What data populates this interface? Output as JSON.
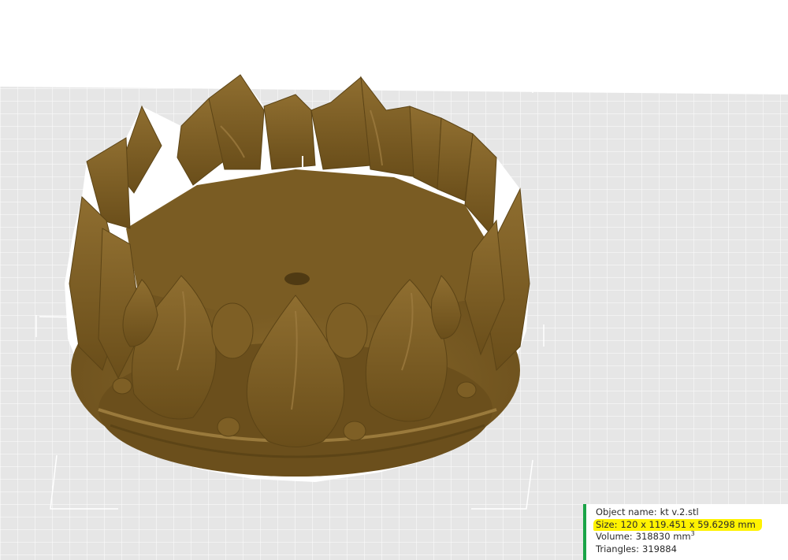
{
  "colors": {
    "bed": "#e6e6e6",
    "grid_line": "#ffffff",
    "model": "#7a5c23",
    "model_shadow": "#5c4416",
    "model_highlight": "#98763a",
    "outline": "#ffffff",
    "panel_accent": "#1aa447",
    "highlight_marker": "#fff200"
  },
  "icons": {
    "model": "crown-3d-model",
    "bounding_box": "bounding-box-corners"
  },
  "object_info": {
    "name_label": "Object name:",
    "name_value": "kt v.2.stl",
    "size_label": "Size:",
    "size_value": "120 x 119.451 x 59.6298 mm",
    "volume_label": "Volume:",
    "volume_value": "318830 mm",
    "volume_unit_sup": "3",
    "triangles_label": "Triangles:",
    "triangles_value": "319884"
  }
}
